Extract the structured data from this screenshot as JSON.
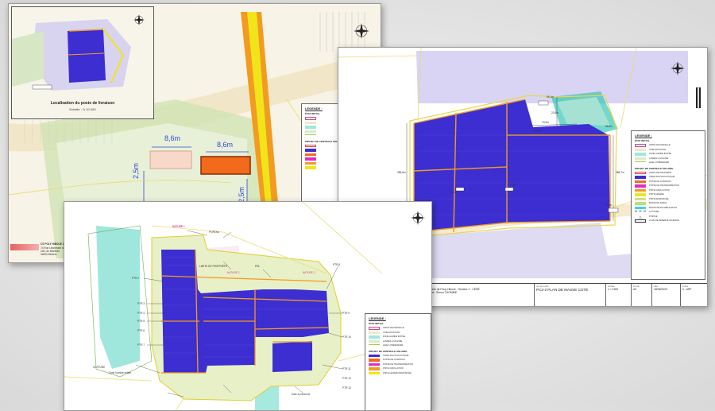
{
  "sheet1": {
    "inset_title": "Localisation du poste de livraison",
    "inset_scale": "Echelle : 1/ 10 000",
    "dim_a": "8,6m",
    "dim_b": "8,6m",
    "dim_c": "2,5m",
    "dim_d": "2,5m",
    "legend_title": "LÉGENDE :",
    "legend_group1": "ÉTAT INITIAL",
    "legend_group2": "PROJET DE CENTRALE SOLAIRE",
    "footer_company": "CS POLY HIBOUE 2",
    "footer_address": [
      "74 Rue Lieutenant de Montcabrier",
      "ZAC de Mazeran",
      "34500 Béziers"
    ]
  },
  "sheet2": {
    "legend_title": "LÉGENDE :",
    "legend_group1": "ÉTAT INITIAL",
    "legend_group2": "PROJET DE CENTRALE SOLAIRE",
    "legend_items_initial": [
      "LIMITE DE PARCELLE",
      "VOIE EXISTANTE",
      "ZONE HUMIDE ÉVITÉE",
      "LANDES À MOLINIE",
      "HAIE À PRÉSERVER"
    ],
    "legend_items_project": [
      "LIMITE DE PROPRIÉTÉ",
      "TABLE PHOTOVOLTAÏQUE",
      "POSTE DE LIVRAISON",
      "POSTE DE TRANSFORMATION",
      "PISTE CIRCULATION",
      "PISTE LÉGÈRE",
      "PISTE RENFORCÉE",
      "BASSE DE SABLE",
      "BASSIN ÉTANCHÉIFICATION",
      "CLÔTURE",
      "PORTAIL",
      "CUVE DE RÉSERVE INCENDIE"
    ],
    "dims": [
      "65,1m",
      "79,9m",
      "385,8m",
      "388,7m",
      "23,8m",
      "66,5m",
      "65,7m",
      "6,8m",
      "8,9m",
      "10,1m",
      "14,8m"
    ],
    "footer": {
      "company": "CS POLY HIBOUE 2",
      "address": [
        "74 Rue Lieutenant de Montcabrier",
        "ZAC de Mazeran",
        "34500 Béziers"
      ],
      "project_head": "projet",
      "project": "Centrale solaire de Pouy Hiboue - Secteur 2 - CÉRÉ",
      "project_sub": "Chef de projet : Simon THOMINE",
      "doc_head": "numéro acte",
      "doc": "PC2-2 PLAN DE MASSE COTÉ",
      "scale_head": "échelle",
      "scale": "1 / 2 500",
      "format_head": "format",
      "format": "A3",
      "date_head": "date",
      "date": "18/05/2023",
      "index_head": "indice",
      "index": "0 - ARF"
    }
  },
  "sheet3": {
    "legend_title": "LÉGENDE :",
    "legend_group1": "ÉTAT INITIAL",
    "legend_group2": "PROJET DE CENTRALE SOLAIRE",
    "legend_items_initial": [
      "LIMITE DE PARCELLE",
      "VOIE EXISTANTE",
      "ZONE HUMIDE ÉVITÉE",
      "LANDES À MOLINIE",
      "HAIE À PRÉSERVER"
    ],
    "legend_items_project": [
      "TABLE PHOTOVOLTAÏQUE",
      "POSTE DE LIVRAISON",
      "POSTE DE TRANSFORMATION",
      "PISTE CIRCULATION",
      "PISTE LÉGÈRE RENFORCÉE"
    ],
    "callouts": [
      "NATURE 1",
      "PORTAIL",
      "NATURE 2",
      "NATURE 2",
      "LIMITE DE PROPRIÉTÉ",
      "PTR 2",
      "PTR 3",
      "PTR 4",
      "PTR 5",
      "PTR 6",
      "PTR 7",
      "PTR 8",
      "PTR 9",
      "PTR 10",
      "PTR 11",
      "PTR 12",
      "PTR 13",
      "PDL",
      "CLÔTURE",
      "Zone humide évitée",
      "Haie à préserver"
    ]
  },
  "colors": {
    "pv": "#3d2ed1",
    "pv_light": "#d6d0f2",
    "orange": "#f29b21",
    "yellow": "#f2e41a",
    "road": "#f5e7c4",
    "green": "#c7dca5",
    "cyan": "#3ed6c6"
  }
}
